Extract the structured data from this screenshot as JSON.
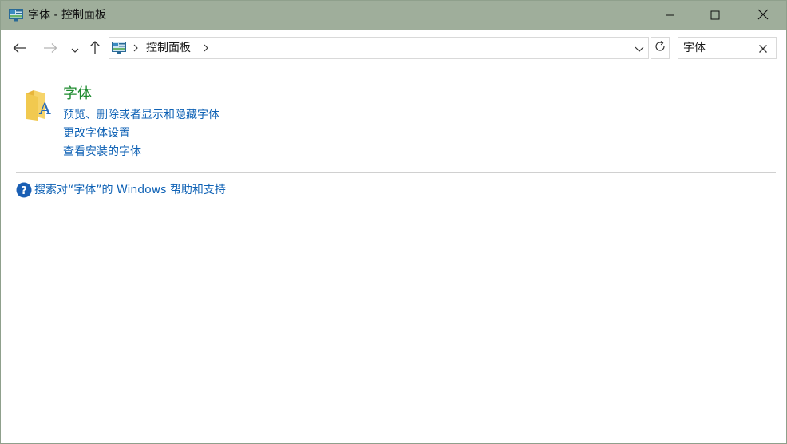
{
  "window": {
    "title": "字体 - 控制面板",
    "icons": {
      "app": "control-panel-icon",
      "minimize": "minimize-icon",
      "maximize": "maximize-icon",
      "close": "close-icon"
    }
  },
  "navigation": {
    "back_icon": "arrow-left-icon",
    "forward_icon": "arrow-right-icon",
    "recent_icon": "chevron-down-icon",
    "up_icon": "arrow-up-icon"
  },
  "address_bar": {
    "breadcrumb": [
      "控制面板"
    ],
    "refresh_icon": "refresh-icon"
  },
  "search": {
    "value": "字体",
    "clear_icon": "close-icon"
  },
  "results": {
    "title": "字体",
    "icon": "fonts-folder-icon",
    "links": [
      "预览、删除或者显示和隐藏字体",
      "更改字体设置",
      "查看安装的字体"
    ]
  },
  "help": {
    "icon": "help-icon",
    "text": "搜索对“字体”的 Windows 帮助和支持"
  },
  "colors": {
    "titlebar": "#9fae9b",
    "link": "#0f62b5",
    "heading": "#1e8b2f",
    "help_icon": "#1a5fb4"
  }
}
